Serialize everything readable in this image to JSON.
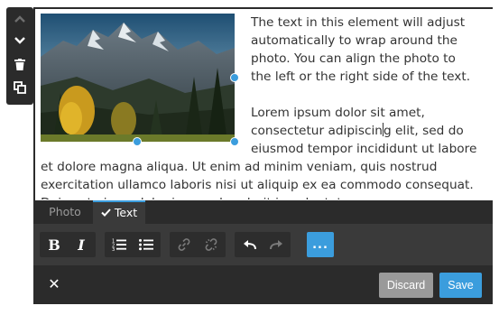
{
  "side_toolbar": {
    "items": [
      {
        "icon": "chevron-up-icon",
        "state": "disabled"
      },
      {
        "icon": "chevron-down-icon",
        "state": "enabled"
      },
      {
        "icon": "trash-icon",
        "state": "enabled"
      },
      {
        "icon": "copy-icon",
        "state": "enabled"
      }
    ]
  },
  "editor": {
    "photo": {
      "alt": "mountain landscape photo",
      "selected": true
    },
    "paragraph_1": "The text in this element will adjust automatically to wrap around the photo. You can align the photo to the left or the right side of the text.",
    "paragraph_2_before_caret": "Lorem ipsum dolor sit amet, consectetur adipiscin",
    "paragraph_2_after_caret": "g elit, sed do eiusmod tempor incididunt ut labore et dolore magna aliqua. Ut enim ad minim veniam, quis nostrud exercitation ullamco laboris nisi ut aliquip ex ea commodo consequat. Duis aute irure dolor in reprehenderit in voluptate."
  },
  "tabs": [
    {
      "label": "Photo",
      "active": false
    },
    {
      "label": "Text",
      "active": true,
      "icon": "check-icon"
    }
  ],
  "format_toolbar": {
    "bold": {
      "label": "B",
      "icon": "bold-icon"
    },
    "italic": {
      "label": "I",
      "icon": "italic-icon"
    },
    "ordered_list": {
      "icon": "ordered-list-icon"
    },
    "unordered_list": {
      "icon": "unordered-list-icon"
    },
    "link": {
      "icon": "link-icon",
      "state": "disabled"
    },
    "unlink": {
      "icon": "unlink-icon",
      "state": "disabled"
    },
    "undo": {
      "icon": "undo-icon"
    },
    "redo": {
      "icon": "redo-icon",
      "state": "disabled"
    },
    "more": {
      "label": "..."
    }
  },
  "footer": {
    "close_label": "✕",
    "discard_label": "Discard",
    "save_label": "Save"
  },
  "colors": {
    "accent": "#3b9ddd",
    "panel": "#2b2b2b",
    "toolbar": "#3a3a3a",
    "discard": "#9a9a9a"
  }
}
